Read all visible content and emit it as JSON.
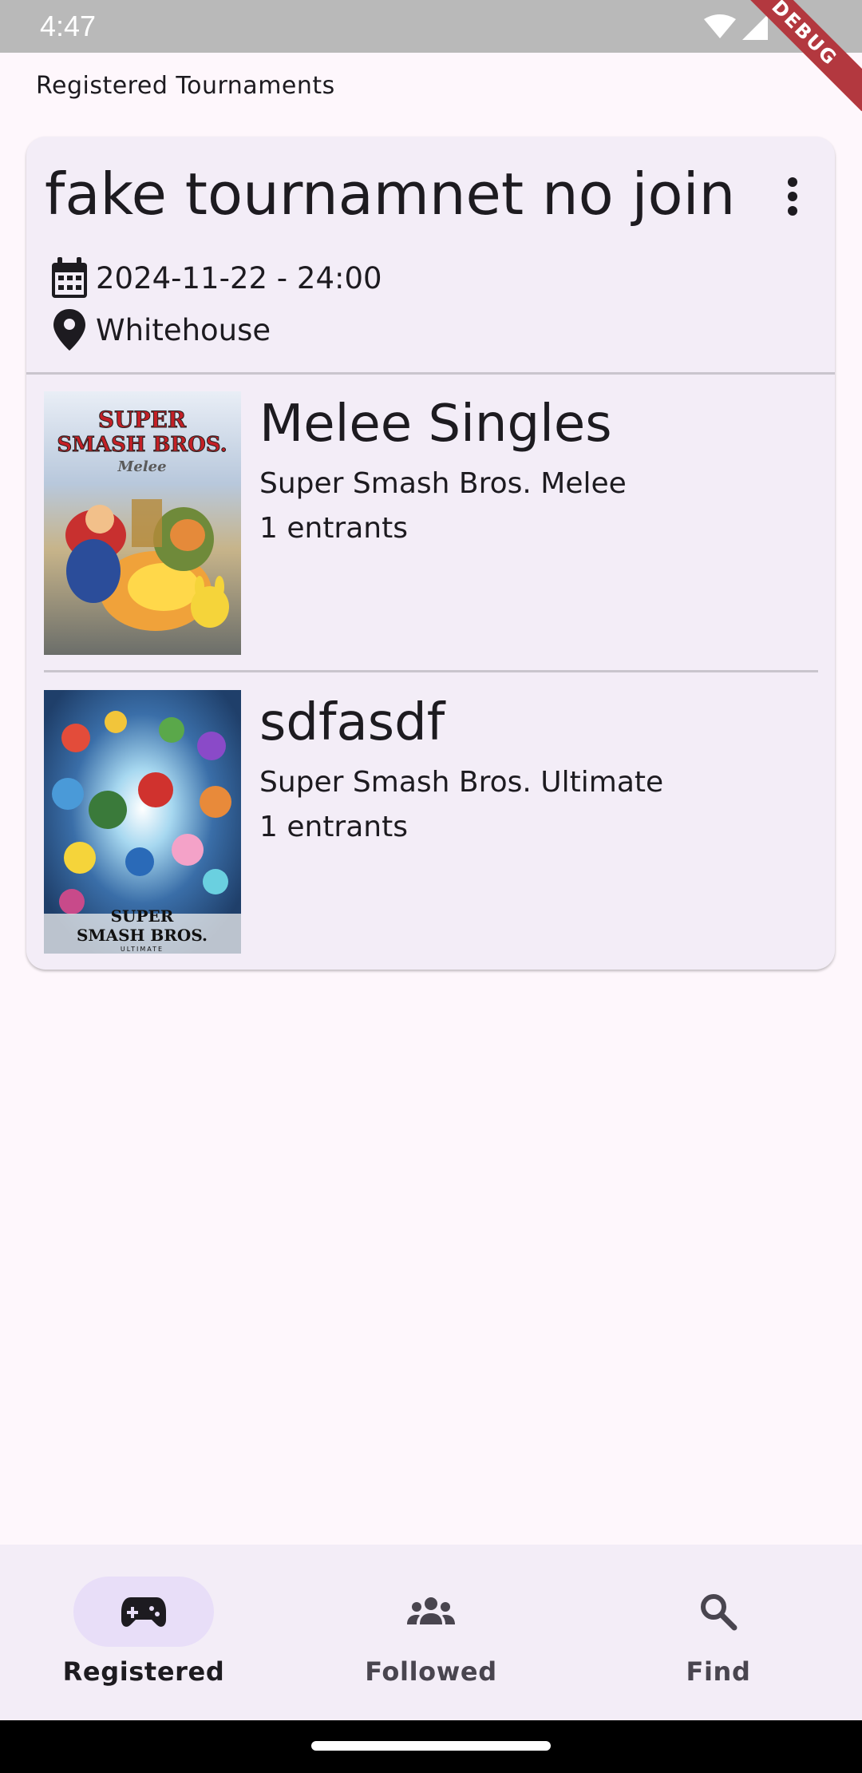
{
  "status_bar": {
    "time": "4:47",
    "debug_label": "DEBUG"
  },
  "header": {
    "title": "Registered Tournaments"
  },
  "tournament": {
    "name": "fake tournamnet no join",
    "date": "2024-11-22 - 24:00",
    "location": "Whitehouse",
    "events": [
      {
        "name": "Melee Singles",
        "game": "Super Smash Bros. Melee",
        "entrants": "1 entrants",
        "cover_icon": "melee-cover-image"
      },
      {
        "name": "sdfasdf",
        "game": "Super Smash Bros. Ultimate",
        "entrants": "1 entrants",
        "cover_icon": "ultimate-cover-image"
      }
    ]
  },
  "cover_art": {
    "melee_title_top": "SUPER",
    "melee_title_mid": "SMASH BROS.",
    "melee_subtitle": "Melee",
    "ultimate_title_top": "SUPER",
    "ultimate_title_mid": "SMASH BROS.",
    "ultimate_subtitle": "ULTIMATE"
  },
  "bottom_nav": {
    "items": [
      {
        "label": "Registered",
        "icon": "gamepad-icon",
        "active": true
      },
      {
        "label": "Followed",
        "icon": "group-icon",
        "active": false
      },
      {
        "label": "Find",
        "icon": "search-icon",
        "active": false
      }
    ]
  },
  "colors": {
    "background": "#fef7fc",
    "card": "#f3edf7",
    "active_pill": "#e8def8",
    "debug_banner": "#b3383f"
  }
}
